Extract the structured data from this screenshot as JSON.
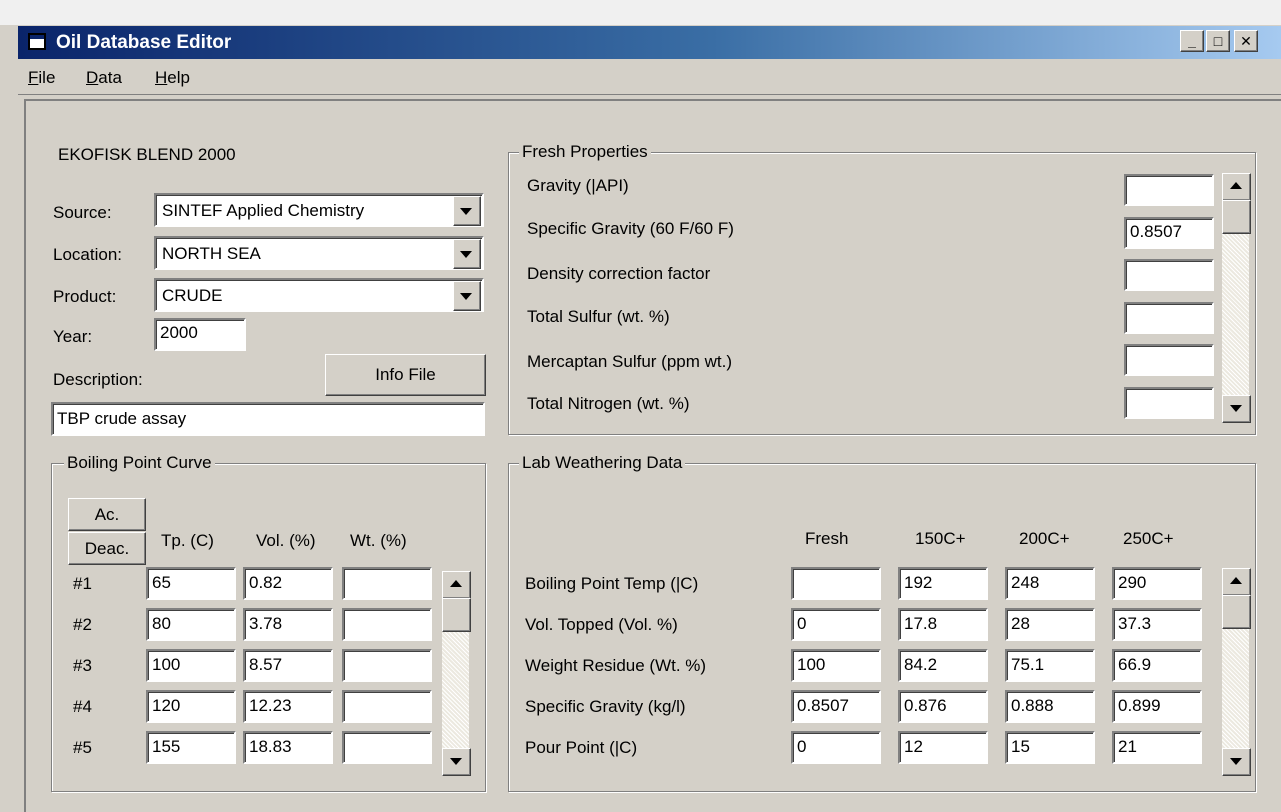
{
  "window": {
    "title": "Oil Database Editor",
    "minimize": "_",
    "maximize": "□",
    "close": "✕"
  },
  "menu": [
    "File",
    "Data",
    "Help"
  ],
  "oil": {
    "name": "EKOFISK BLEND 2000",
    "source_label": "Source:",
    "source": "SINTEF Applied Chemistry",
    "location_label": "Location:",
    "location": "NORTH SEA",
    "product_label": "Product:",
    "product": "CRUDE",
    "year_label": "Year:",
    "year": "2000",
    "description_label": "Description:",
    "description": "TBP crude assay",
    "info_file_button": "Info File"
  },
  "fresh": {
    "title": "Fresh Properties",
    "rows": [
      {
        "label": "Gravity (|API)",
        "value": ""
      },
      {
        "label": "Specific Gravity (60 F/60 F)",
        "value": "0.8507"
      },
      {
        "label": "Density correction factor",
        "value": ""
      },
      {
        "label": "Total Sulfur (wt. %)",
        "value": ""
      },
      {
        "label": "Mercaptan Sulfur (ppm wt.)",
        "value": ""
      },
      {
        "label": "Total Nitrogen (wt. %)",
        "value": ""
      }
    ]
  },
  "bp": {
    "title": "Boiling Point Curve",
    "ac_button": "Ac.",
    "deac_button": "Deac.",
    "headers": [
      "Tp. (C)",
      "Vol. (%)",
      "Wt. (%)"
    ],
    "rows": [
      {
        "id": "#1",
        "tp": "65",
        "vol": "0.82",
        "wt": ""
      },
      {
        "id": "#2",
        "tp": "80",
        "vol": "3.78",
        "wt": ""
      },
      {
        "id": "#3",
        "tp": "100",
        "vol": "8.57",
        "wt": ""
      },
      {
        "id": "#4",
        "tp": "120",
        "vol": "12.23",
        "wt": ""
      },
      {
        "id": "#5",
        "tp": "155",
        "vol": "18.83",
        "wt": ""
      }
    ]
  },
  "lab": {
    "title": "Lab Weathering Data",
    "headers": [
      "Fresh",
      "150C+",
      "200C+",
      "250C+"
    ],
    "rows": [
      {
        "label": "Boiling Point Temp (|C)",
        "values": [
          "",
          "192",
          "248",
          "290"
        ]
      },
      {
        "label": "Vol. Topped (Vol. %)",
        "values": [
          "0",
          "17.8",
          "28",
          "37.3"
        ]
      },
      {
        "label": "Weight Residue (Wt. %)",
        "values": [
          "100",
          "84.2",
          "75.1",
          "66.9"
        ]
      },
      {
        "label": "Specific Gravity (kg/l)",
        "values": [
          "0.8507",
          "0.876",
          "0.888",
          "0.899"
        ]
      },
      {
        "label": "Pour Point (|C)",
        "values": [
          "0",
          "12",
          "15",
          "21"
        ]
      }
    ]
  }
}
